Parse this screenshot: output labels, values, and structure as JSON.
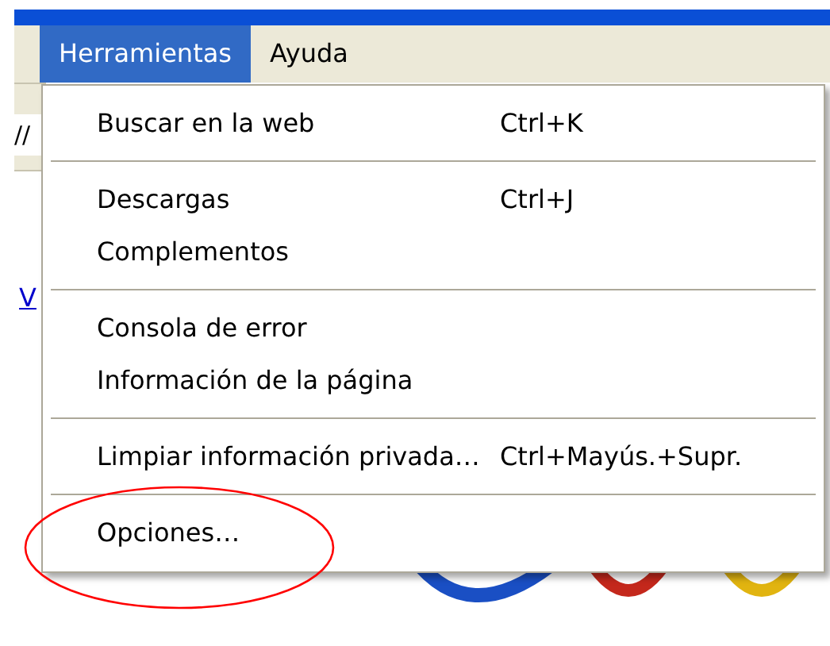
{
  "menu_bar": [
    {
      "label": "Herramientas",
      "selected": true
    },
    {
      "label": "Ayuda",
      "selected": false
    }
  ],
  "background": {
    "address_fragment": "//",
    "link_fragment": "V"
  },
  "menu": [
    {
      "kind": "item",
      "label": "Buscar en la web",
      "shortcut": "Ctrl+K"
    },
    {
      "kind": "separator"
    },
    {
      "kind": "item",
      "label": "Descargas",
      "shortcut": "Ctrl+J"
    },
    {
      "kind": "item",
      "label": "Complementos"
    },
    {
      "kind": "separator"
    },
    {
      "kind": "item",
      "label": "Consola de error"
    },
    {
      "kind": "item",
      "label": "Información de la página"
    },
    {
      "kind": "separator"
    },
    {
      "kind": "item",
      "label": "Limpiar información privada…",
      "shortcut": "Ctrl+Mayús.+Supr."
    },
    {
      "kind": "separator"
    },
    {
      "kind": "item",
      "label": "Opciones…",
      "highlighted": true
    }
  ]
}
